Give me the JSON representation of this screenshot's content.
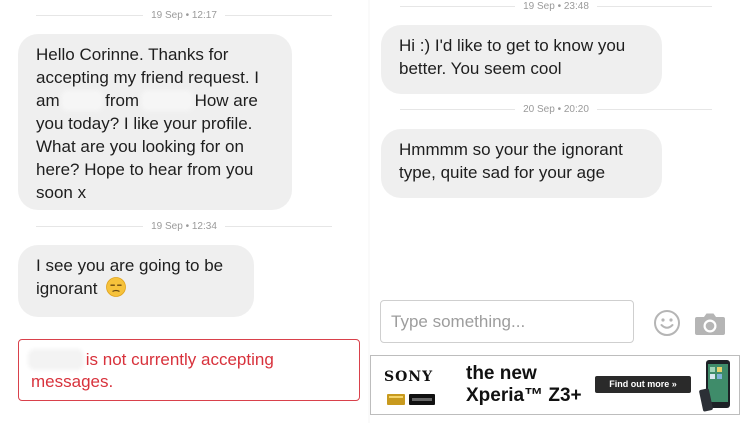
{
  "left": {
    "timestamps": [
      "19 Sep • 12:17",
      "19 Sep • 12:34"
    ],
    "messages": {
      "m1": {
        "p1": "Hello Corinne. Thanks for",
        "p2": "accepting my friend request. I",
        "p3a": "am",
        "p3b": "from",
        "p3c": "How are",
        "p4": "you today? I like your profile.",
        "p5": "What are you looking for on",
        "p6": "here? Hope to hear from you",
        "p7": "soon x"
      },
      "m2": {
        "l1": "I see you are going to be",
        "l2": "ignorant"
      }
    },
    "warning": {
      "text": "is not currently accepting",
      "text2": "messages."
    }
  },
  "right": {
    "timestamps": [
      "19 Sep • 23:48",
      "20 Sep • 20:20"
    ],
    "messages": {
      "m1": {
        "l1": "Hi :) I'd like to get to know you",
        "l2": "better. You seem cool"
      },
      "m2": {
        "l1": "Hmmmm so your the ignorant",
        "l2": "type, quite sad for your age"
      }
    },
    "composer": {
      "placeholder": "Type something...",
      "emoji_icon": "smiley-icon",
      "camera_icon": "camera-icon"
    }
  },
  "ad": {
    "brand": "SONY",
    "headline1": "the new",
    "headline2": "Xperia™ Z3+",
    "cta": "Find out more »"
  },
  "colors": {
    "bubble": "#efefef",
    "warning": "#d8323c",
    "timestamp": "#9a9a9a"
  }
}
